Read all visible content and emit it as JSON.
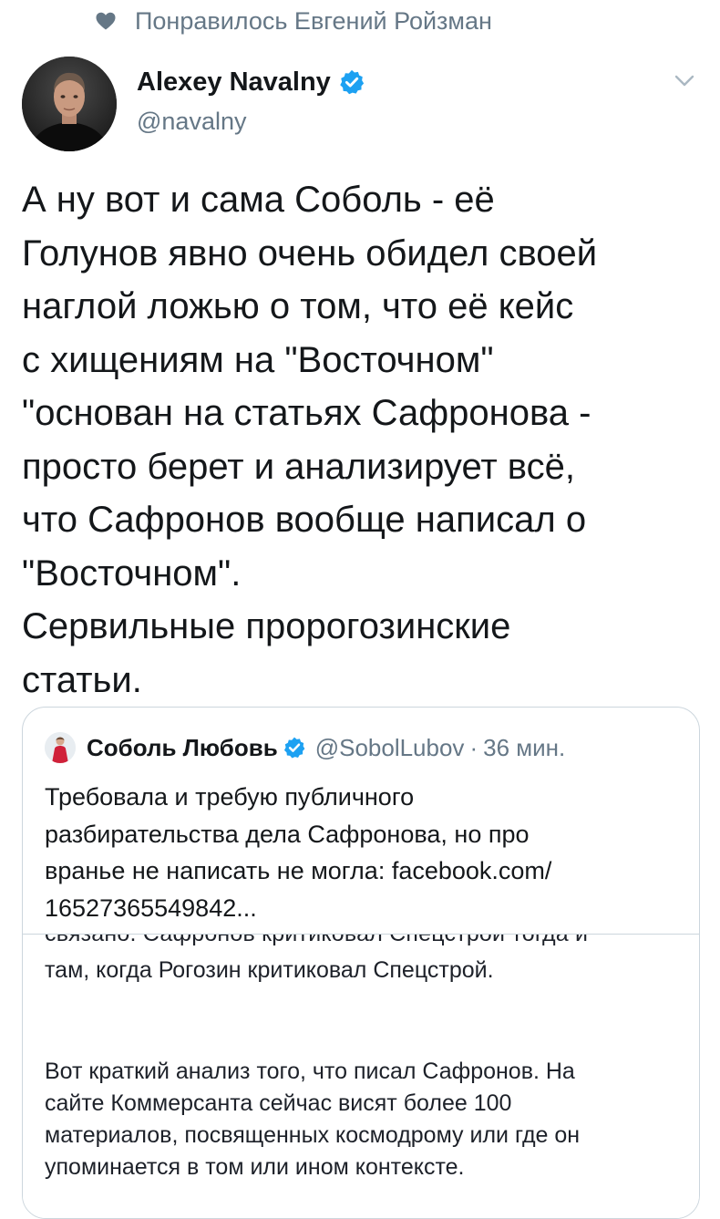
{
  "social_context": {
    "icon": "heart-icon",
    "text": "Понравилось Евгений Ройзман"
  },
  "tweet": {
    "author": {
      "name": "Alexey Navalny",
      "handle": "@navalny",
      "verified": true
    },
    "text_lines": [
      "А ну вот и сама Соболь - её",
      "Голунов явно очень обидел своей",
      "наглой ложью о том, что её кейс",
      "с хищениям на \"Восточном\"",
      "\"основан на статьях Сафронова -",
      "просто берет и анализирует всё,",
      "что Сафронов вообще написал о",
      "\"Восточном\".",
      "Сервильные пророгозинские",
      "статьи."
    ]
  },
  "quoted_tweet": {
    "author": {
      "name": "Соболь Любовь",
      "handle": "@SobolLubov",
      "separator": "·",
      "time": "36 мин.",
      "verified": true
    },
    "text_lines": [
      "Требовала и требую публичного",
      "разбирательства дела Сафронова, но про",
      "вранье не написать не могла: facebook.com/",
      "16527365549842..."
    ],
    "media": {
      "cut_line": "связано. Сафронов критиковал Спецстрой тогда и",
      "paragraph1": [
        "там, когда Рогозин критиковал Спецстрой."
      ],
      "paragraph2": [
        "Вот краткий анализ того, что писал Сафронов. На",
        "сайте Коммерсанта сейчас висят более 100",
        "материалов, посвященных космодрому или где он",
        "упоминается в том или ином контексте."
      ]
    }
  },
  "colors": {
    "text": "#14171a",
    "secondary": "#657786",
    "verified": "#1da1f2",
    "border": "#ccd6dd"
  }
}
